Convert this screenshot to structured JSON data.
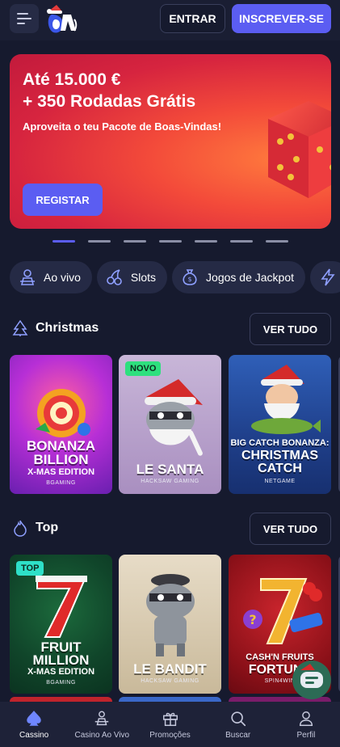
{
  "header": {
    "login_label": "ENTRAR",
    "signup_label": "INSCREVER-SE"
  },
  "banner": {
    "title_line1": "Até 15.000 €",
    "title_line2": "+ 350 Rodadas Grátis",
    "subtitle": "Aproveita o teu Pacote de Boas-Vindas!",
    "cta_label": "REGISTAR",
    "slides_total": 7,
    "active_slide": 1
  },
  "categories": [
    {
      "label": "Ao vivo",
      "icon": "live-dealer-icon"
    },
    {
      "label": "Slots",
      "icon": "cherry-icon"
    },
    {
      "label": "Jogos de Jackpot",
      "icon": "money-bag-icon"
    },
    {
      "label": "",
      "icon": "lightning-icon"
    }
  ],
  "sections": {
    "christmas": {
      "title": "Christmas",
      "icon": "christmas-tree-icon",
      "view_all_label": "VER TUDO",
      "games": [
        {
          "title_line1": "BONANZA",
          "title_line2": "BILLION",
          "subtitle": "X-MAS EDITION",
          "provider": "BGAMING",
          "badge": ""
        },
        {
          "title_line1": "LE SANTA",
          "title_line2": "",
          "subtitle": "",
          "provider": "HACKSAW GAMING",
          "badge": "NOVO"
        },
        {
          "title_line1": "BIG CATCH BONANZA:",
          "title_line2": "CHRISTMAS",
          "subtitle": "CATCH",
          "provider": "NETGAME",
          "badge": ""
        }
      ]
    },
    "top": {
      "title": "Top",
      "icon": "fire-icon",
      "view_all_label": "VER TUDO",
      "games": [
        {
          "title_line1": "FRUIT",
          "title_line2": "MILLION",
          "subtitle": "X-MAS EDITION",
          "provider": "BGAMING",
          "badge": "TOP"
        },
        {
          "title_line1": "LE BANDIT",
          "title_line2": "",
          "subtitle": "",
          "provider": "HACKSAW GAMING",
          "badge": ""
        },
        {
          "title_line1": "CASH'N FRUITS",
          "title_line2": "FORTUNE",
          "subtitle": "",
          "provider": "SPIN4WIN",
          "badge": ""
        }
      ]
    }
  },
  "bottom_nav": [
    {
      "label": "Cassino",
      "icon": "spade-icon",
      "active": true
    },
    {
      "label": "Casino Ao Vivo",
      "icon": "dealer-icon",
      "active": false
    },
    {
      "label": "Promoções",
      "icon": "gift-icon",
      "active": false
    },
    {
      "label": "Buscar",
      "icon": "search-icon",
      "active": false
    },
    {
      "label": "Perfil",
      "icon": "user-icon",
      "active": false
    }
  ],
  "colors": {
    "background": "#161a2e",
    "accent": "#5b5df2",
    "banner_red": "#e0303f",
    "badge_green": "#2ee07e"
  }
}
